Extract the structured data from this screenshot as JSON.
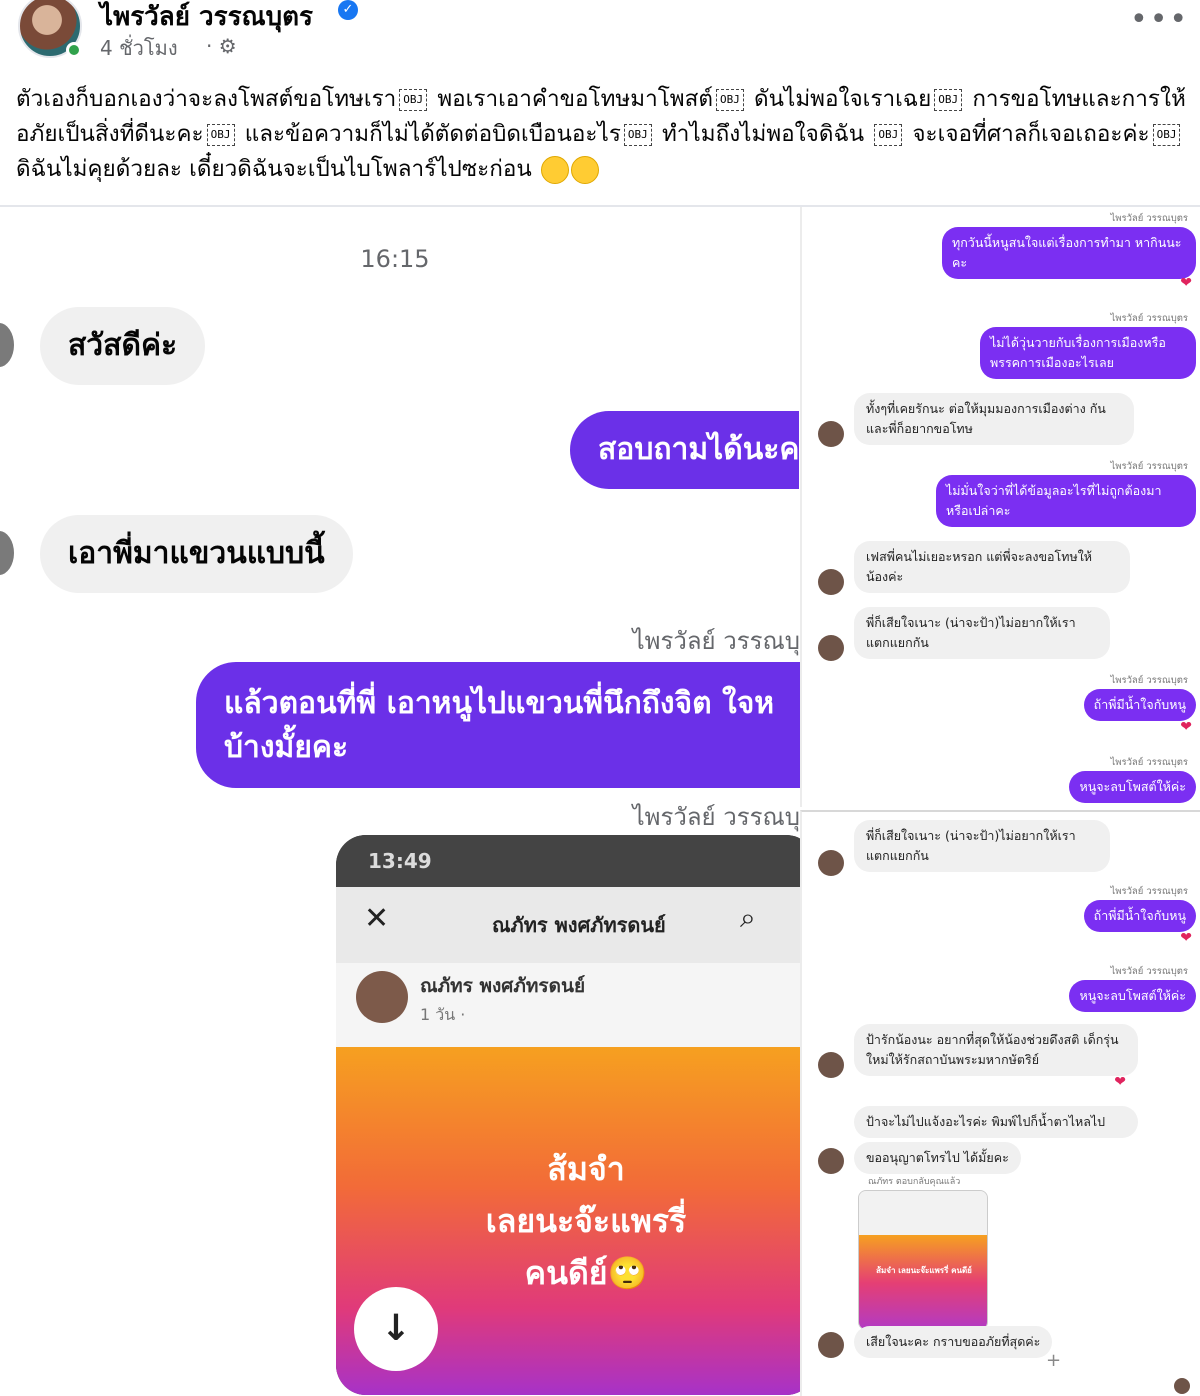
{
  "post": {
    "author": "ไพรวัลย์ วรรณบุตร",
    "time": "4 ชั่วโมง",
    "privacy_icon": "gear-icon",
    "more_icon": "•••",
    "obj_marker": "OBJ",
    "text_parts": [
      "ตัวเองก็บอกเองว่าจะลงโพสต์ขอโทษเรา",
      "พอเราเอาคำขอโทษมาโพสต์",
      "ดันไม่พอใจเราเฉย",
      "การขอโทษและการให้อภัยเป็นสิ่งที่ดีนะคะ",
      "และข้อความก็ไม่ได้ตัดต่อบิดเบือนอะไร",
      "ทำไมถึงไม่พอใจดิฉัน",
      "จะเจอที่ศาลก็เจอเถอะค่ะ",
      "ดิฉันไม่คุยด้วยละ เดี๋ยวดิฉันจะเป็นไบโพลาร์ไปซะก่อน"
    ]
  },
  "left_chat": {
    "time": "16:15",
    "messages": [
      {
        "text": "สวัสดีค่ะ"
      },
      {
        "text": "สอบถามได้นะค"
      },
      {
        "text": "เอาพี่มาแขวนแบบนี้"
      },
      {
        "text": "แล้วตอนที่พี่ เอาหนูไปแขวนพี่นึกถึงจิต ใจห"
      },
      {
        "text": "บ้างมั้ยคะ"
      }
    ],
    "sender_label": "ไพรวัลย์ วรรณบุ",
    "shared_card": {
      "status_time": "13:49",
      "title": "ณภัทร พงศภัทรดนย์",
      "user_name": "ณภัทร พงศภัทรดนย์",
      "user_time": "1 วัน ·",
      "body_line1": "ส้มจำ",
      "body_line2": "เลยนะจ๊ะแพรรี่",
      "body_line3": "คนดีย์🙄"
    }
  },
  "right_top": {
    "sender_label": "ไพรวัลย์ วรรณบุตร",
    "messages": [
      {
        "dir": "out",
        "text": "ทุกวันนี้หนูสนใจแต่เรื่องการทำมา หากินนะคะ"
      },
      {
        "dir": "out",
        "text": "ไม่ได้วุ่นวายกับเรื่องการเมืองหรือ พรรคการเมืองอะไรเลย"
      },
      {
        "dir": "in",
        "text": "ทั้งๆที่เคยรักนะ ต่อให้มุมมองการเมืองต่าง กัน และพี่ก็อยากขอโทษ"
      },
      {
        "dir": "out",
        "text": "ไม่มั่นใจว่าพี่ได้ข้อมูลอะไรที่ไม่ถูกต้องมา หรือเปล่าคะ"
      },
      {
        "dir": "in",
        "text": "เฟสพี่คนไม่เยอะหรอก แต่พี่จะลงขอโทษให้ น้องค่ะ"
      },
      {
        "dir": "in",
        "text": "พี่ก็เสียใจเนาะ (น่าจะป้า)ไม่อยากให้เรา แตกแยกกัน"
      },
      {
        "dir": "out",
        "text": "ถ้าพี่มีน้ำใจกับหนู"
      },
      {
        "dir": "out",
        "text": "หนูจะลบโพสต์ให้ค่ะ"
      }
    ]
  },
  "right_bottom": {
    "sender_label": "ไพรวัลย์ วรรณบุตร",
    "messages": [
      {
        "dir": "in",
        "text": "พี่ก็เสียใจเนาะ (น่าจะป้า)ไม่อยากให้เรา แตกแยกกัน"
      },
      {
        "dir": "out",
        "text": "ถ้าพี่มีน้ำใจกับหนู"
      },
      {
        "dir": "out",
        "text": "หนูจะลบโพสต์ให้ค่ะ"
      },
      {
        "dir": "in",
        "text": "ป้ารักน้องนะ อยากที่สุดให้น้องช่วยดึงสติ เด็กรุ่นใหม่ให้รักสถาบันพระมหากษัตริย์"
      },
      {
        "dir": "in",
        "text": "ป้าจะไม่ไปแจ้งอะไรค่ะ พิมพ์ไปก็น้ำตาไหลไป"
      },
      {
        "dir": "in",
        "text": "ขออนุญาตโทรไป ได้มั้ยคะ"
      },
      {
        "dir": "in",
        "text": "เสียใจนะคะ กราบขออภัยที่สุดค่ะ"
      }
    ],
    "reply_label": "ณภัทร ตอบกลับคุณแล้ว",
    "mini_card_text": "ส้มจำ เลยนะจ๊ะแพรรี่ คนดีย์"
  },
  "colors": {
    "messenger_purple": "#6b30e8",
    "verified_blue": "#1877f2",
    "online_green": "#31a24c",
    "heart_red": "#e0245e"
  }
}
